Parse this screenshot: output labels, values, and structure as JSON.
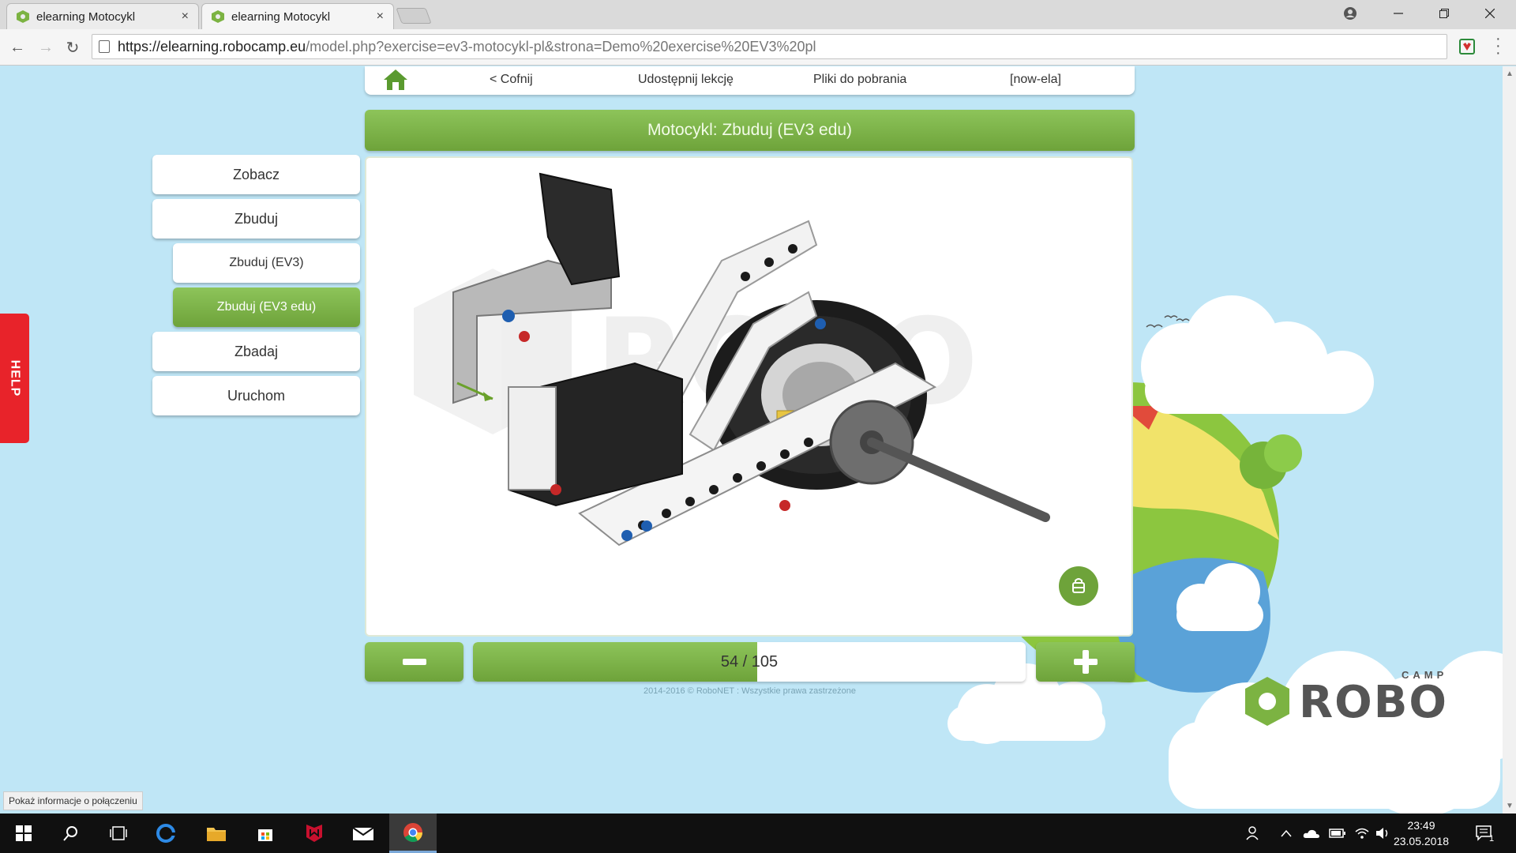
{
  "browser": {
    "tabs": [
      {
        "title": "elearning Motocykl",
        "close": "×"
      },
      {
        "title": "elearning Motocykl",
        "close": "×"
      }
    ],
    "url_host": "https://elearning.robocamp.eu",
    "url_path": "/model.php?exercise=ev3-motocykl-pl&strona=Demo%20exercise%20EV3%20pl"
  },
  "topnav": {
    "back": "< Cofnij",
    "share": "Udostępnij lekcję",
    "downloads": "Pliki do pobrania",
    "user": "[now-ela]"
  },
  "title": "Motocykl: Zbuduj (EV3 edu)",
  "sidebar": {
    "items": [
      {
        "label": "Zobacz"
      },
      {
        "label": "Zbuduj"
      },
      {
        "label": "Zbuduj (EV3)"
      },
      {
        "label": "Zbuduj (EV3 edu)"
      },
      {
        "label": "Zbadaj"
      },
      {
        "label": "Uruchom"
      }
    ]
  },
  "viewer": {
    "current_step": 54,
    "total_steps": 105,
    "counter": "54 / 105"
  },
  "help": "HELP",
  "copyright": "2014-2016 © RoboNET : Wszystkie prawa zastrzeżone",
  "logo": {
    "camp": "CAMP",
    "robo": "ROBO"
  },
  "status_tip": "Pokaż informacje o połączeniu",
  "taskbar": {
    "time": "23:49",
    "date": "23.05.2018",
    "notifications": "1"
  },
  "colors": {
    "accent_green": "#7cb342",
    "help_red": "#e8232a",
    "sky": "#bfe6f6"
  }
}
